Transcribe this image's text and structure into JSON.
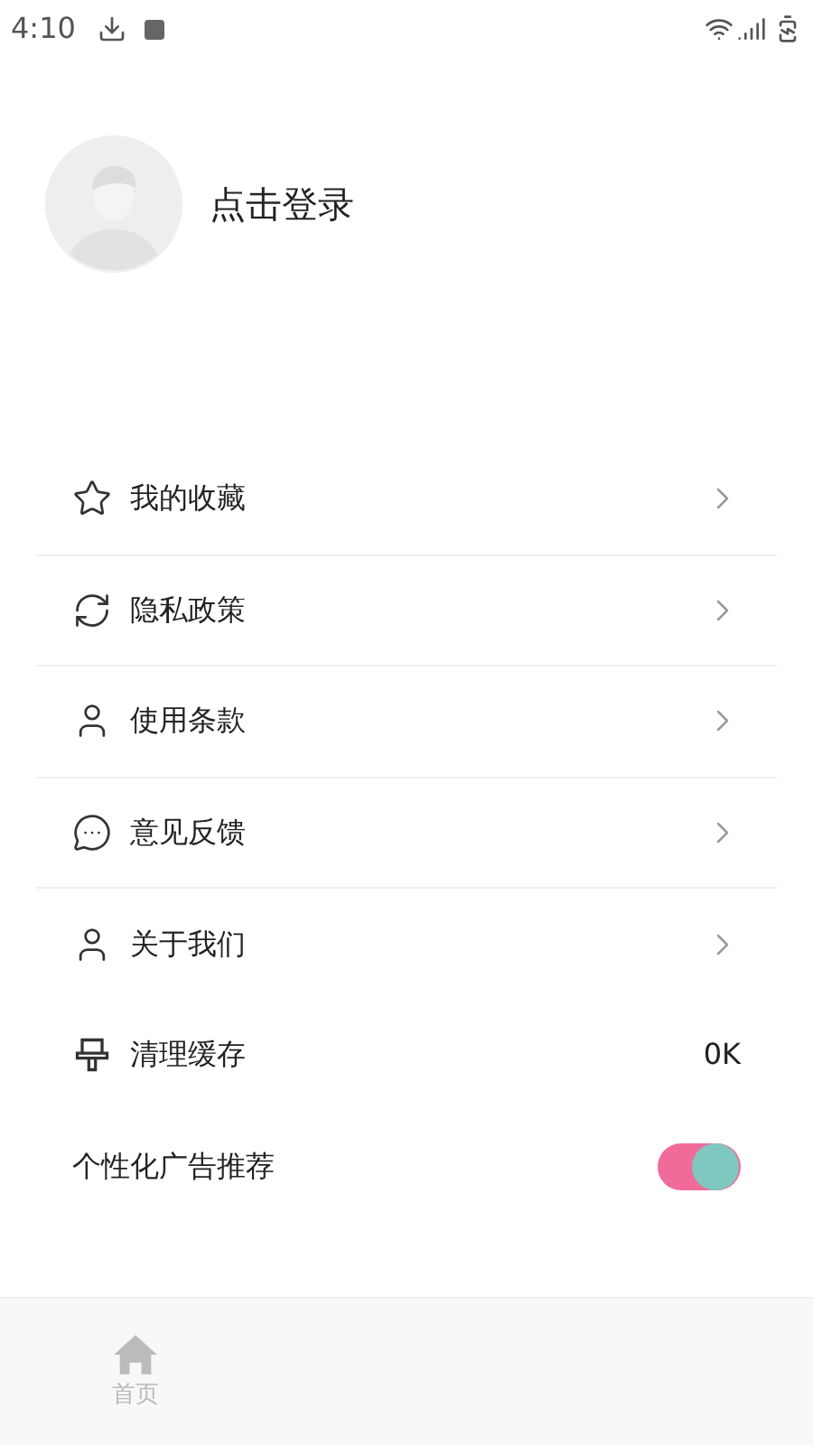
{
  "status_bar": {
    "time": "4:10"
  },
  "profile": {
    "name": "点击登录"
  },
  "menu": [
    {
      "kind": "link",
      "label": "我的收藏"
    },
    {
      "kind": "link",
      "label": "隐私政策"
    },
    {
      "kind": "link",
      "label": "使用条款"
    },
    {
      "kind": "link",
      "label": "意见反馈"
    },
    {
      "kind": "link",
      "label": "关于我们"
    },
    {
      "kind": "value",
      "label": "清理缓存",
      "value": "0K"
    },
    {
      "kind": "toggle",
      "label": "个性化广告推荐",
      "on": true
    }
  ],
  "bottom_nav": [
    {
      "label": "首页",
      "selected": false
    }
  ]
}
